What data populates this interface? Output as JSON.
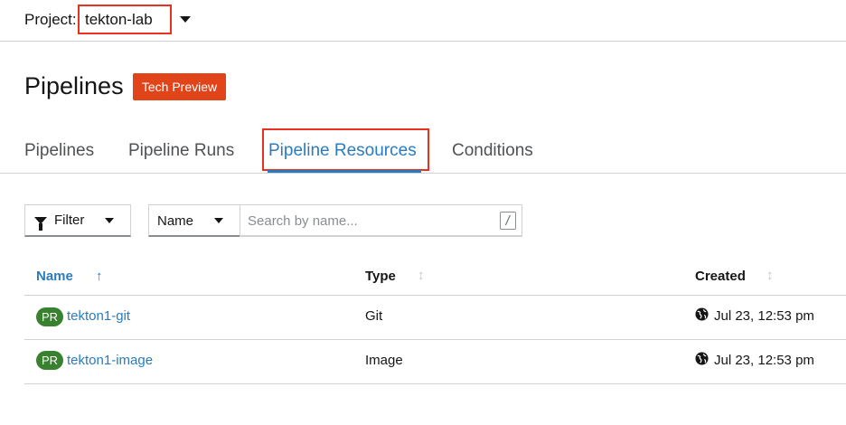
{
  "project": {
    "label": "Project:",
    "name": "tekton-lab"
  },
  "page": {
    "title": "Pipelines",
    "badge": "Tech Preview"
  },
  "tabs": [
    {
      "label": "Pipelines"
    },
    {
      "label": "Pipeline Runs"
    },
    {
      "label": "Pipeline Resources",
      "active": true
    },
    {
      "label": "Conditions"
    }
  ],
  "toolbar": {
    "filter_label": "Filter",
    "name_select": "Name",
    "search_placeholder": "Search by name...",
    "search_shortcut": "/"
  },
  "table": {
    "columns": {
      "name": "Name",
      "type": "Type",
      "created": "Created"
    },
    "rows": [
      {
        "badge": "PR",
        "name": "tekton1-git",
        "type": "Git",
        "created": "Jul 23, 12:53 pm"
      },
      {
        "badge": "PR",
        "name": "tekton1-image",
        "type": "Image",
        "created": "Jul 23, 12:53 pm"
      }
    ]
  },
  "colors": {
    "accent": "#2b7bbf",
    "badge": "#e2441a",
    "resource_badge": "#38812f",
    "highlight": "#e8321f"
  }
}
